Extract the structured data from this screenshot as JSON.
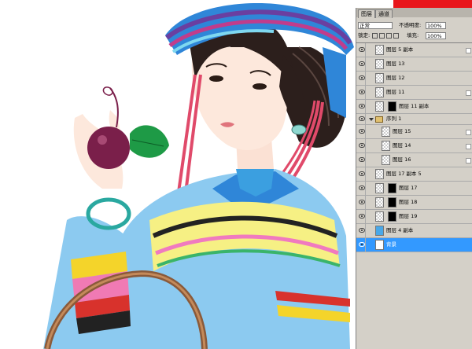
{
  "layers_panel": {
    "tabs": [
      "图层",
      "通道"
    ],
    "blend_mode": "正常",
    "opacity_label": "不透明度:",
    "opacity_value": "100%",
    "lock_label": "锁定:",
    "fill_label": "填充:",
    "fill_value": "100%",
    "layers": [
      {
        "name": "图层 5 副本",
        "type": "pixel"
      },
      {
        "name": "图层 13",
        "type": "pixel"
      },
      {
        "name": "图层 12",
        "type": "pixel"
      },
      {
        "name": "图层 11",
        "type": "pixel"
      },
      {
        "name": "图层 11 副本",
        "type": "mask"
      },
      {
        "name": "序列 1",
        "type": "group"
      },
      {
        "name": "图层 15",
        "type": "pixel"
      },
      {
        "name": "图层 14",
        "type": "pixel"
      },
      {
        "name": "图层 16",
        "type": "pixel"
      },
      {
        "name": "图层 17 副本 5",
        "type": "pixel"
      },
      {
        "name": "图层 17",
        "type": "mask"
      },
      {
        "name": "图层 18",
        "type": "mask"
      },
      {
        "name": "图层 19",
        "type": "mask"
      },
      {
        "name": "图层 4 副本",
        "type": "pixel"
      },
      {
        "name": "背景",
        "type": "background",
        "selected": true
      }
    ]
  },
  "colors": {
    "selection": "#3399ff",
    "panel_bg": "#d4d0c8",
    "red_bar": "#e8161b"
  }
}
